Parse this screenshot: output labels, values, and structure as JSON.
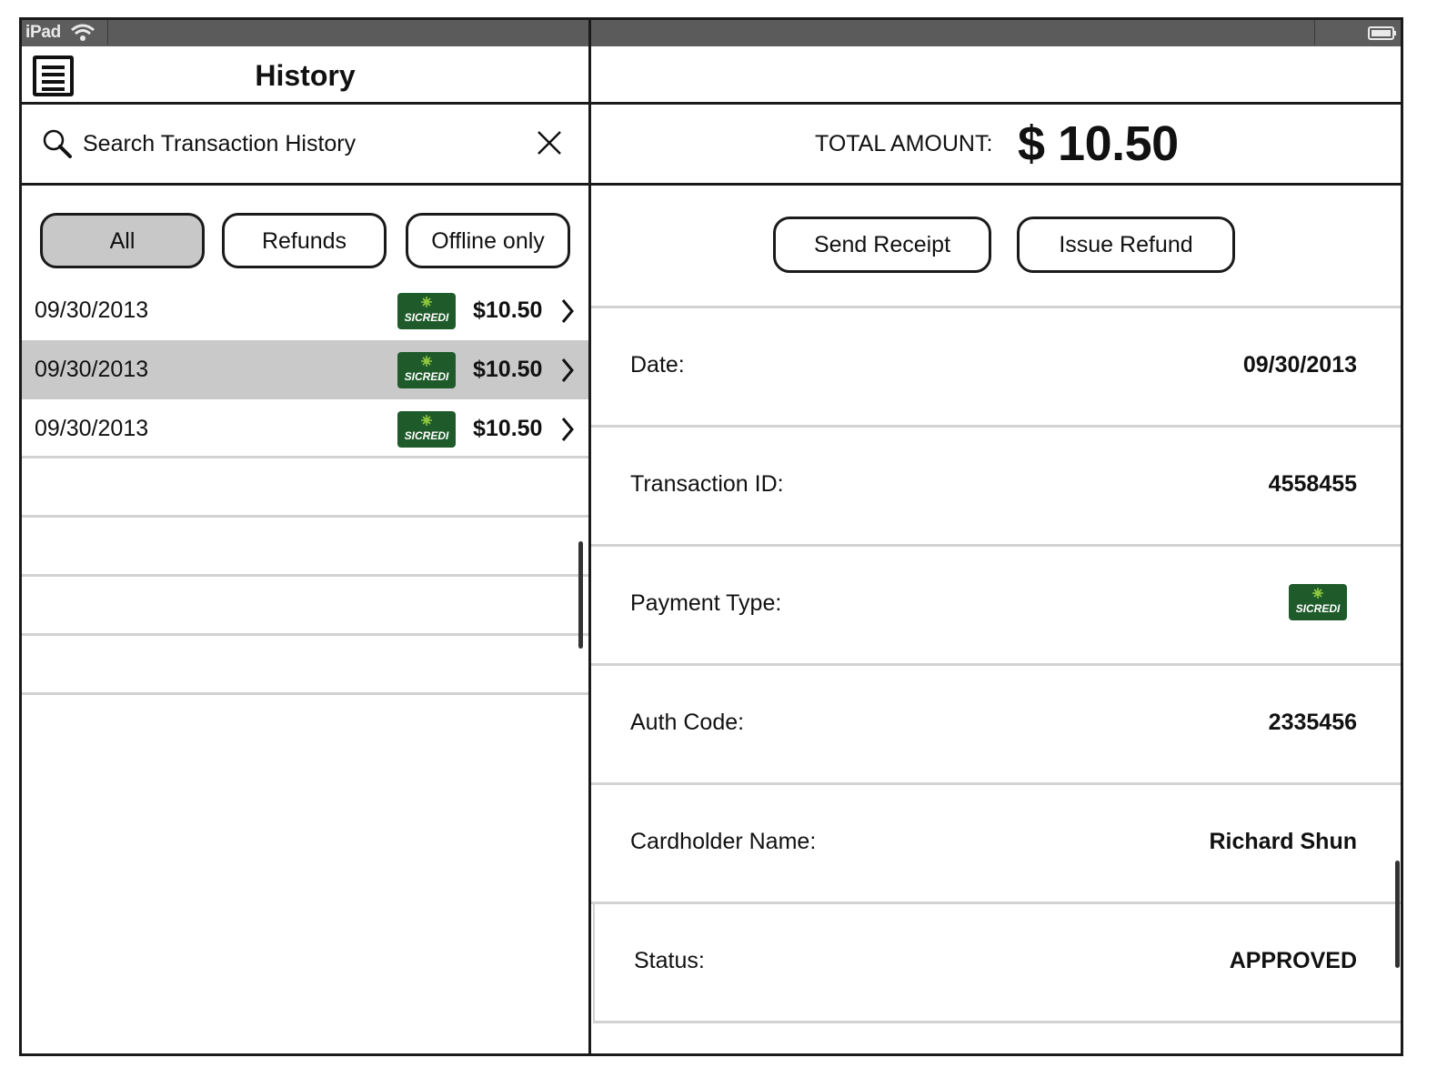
{
  "status_bar": {
    "carrier": "iPad"
  },
  "header": {
    "title": "History"
  },
  "search": {
    "placeholder": "Search Transaction History"
  },
  "filters": [
    {
      "label": "All",
      "active": true
    },
    {
      "label": "Refunds",
      "active": false
    },
    {
      "label": "Offline only",
      "active": false
    }
  ],
  "transactions": [
    {
      "date": "09/30/2013",
      "amount": "$10.50",
      "card": "SICREDI",
      "selected": false
    },
    {
      "date": "09/30/2013",
      "amount": "$10.50",
      "card": "SICREDI",
      "selected": true
    },
    {
      "date": "09/30/2013",
      "amount": "$10.50",
      "card": "SICREDI",
      "selected": false
    }
  ],
  "total": {
    "label": "TOTAL AMOUNT:",
    "value": "$ 10.50"
  },
  "actions": {
    "send_receipt": "Send Receipt",
    "issue_refund": "Issue Refund"
  },
  "details": {
    "date": {
      "label": "Date:",
      "value": "09/30/2013"
    },
    "transaction_id": {
      "label": "Transaction ID:",
      "value": "4558455"
    },
    "payment_type": {
      "label": "Payment Type:",
      "card": "SICREDI"
    },
    "auth_code": {
      "label": "Auth Code:",
      "value": "2335456"
    },
    "cardholder": {
      "label": "Cardholder Name:",
      "value": "Richard Shun"
    },
    "status": {
      "label": "Status:",
      "value": "APPROVED"
    }
  },
  "colors": {
    "card_green": "#1f5b2a",
    "card_leaf": "#8cc63f",
    "selected_row": "#c9c9c9"
  }
}
